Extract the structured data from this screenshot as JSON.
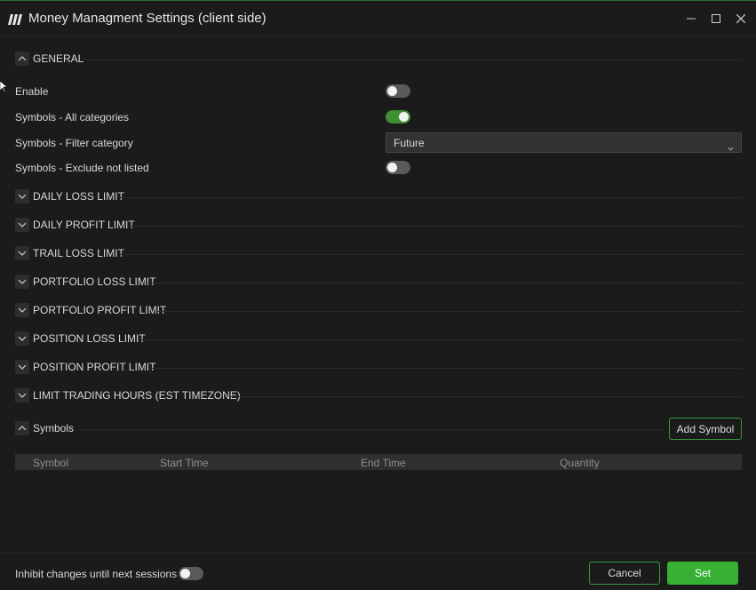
{
  "window": {
    "title": "Money Managment Settings (client side)",
    "accent_color": "#35b032",
    "controls": [
      "minimize-icon",
      "maximize-icon",
      "close-icon"
    ]
  },
  "general": {
    "header": "GENERAL",
    "expanded": true,
    "settings": [
      {
        "label": "Enable",
        "type": "toggle",
        "value": false
      },
      {
        "label": "Symbols - All categories",
        "type": "toggle",
        "value": true
      },
      {
        "label": "Symbols - Filter category",
        "type": "select",
        "value": "Future"
      },
      {
        "label": "Symbols - Exclude not listed",
        "type": "toggle",
        "value": false
      }
    ]
  },
  "sections": [
    {
      "header": "DAILY LOSS LIMIT",
      "expanded": false
    },
    {
      "header": "DAILY PROFIT LIMIT",
      "expanded": false
    },
    {
      "header": "TRAIL LOSS LIMIT",
      "expanded": false
    },
    {
      "header": "PORTFOLIO LOSS LIMIT",
      "expanded": false
    },
    {
      "header": "PORTFOLIO PROFIT LIMIT",
      "expanded": false
    },
    {
      "header": "POSITION LOSS LIMIT",
      "expanded": false
    },
    {
      "header": "POSITION PROFIT LIMIT",
      "expanded": false
    },
    {
      "header": "LIMIT TRADING HOURS (EST TIMEZONE)",
      "expanded": false
    }
  ],
  "symbols": {
    "header": "Symbols",
    "expanded": true,
    "add_button": "Add Symbol",
    "columns": [
      "Symbol",
      "Start Time",
      "End Time",
      "Quantity"
    ],
    "rows": []
  },
  "footer": {
    "inhibit_label": "Inhibit changes until next sessions",
    "inhibit_value": false,
    "cancel_label": "Cancel",
    "set_label": "Set"
  }
}
